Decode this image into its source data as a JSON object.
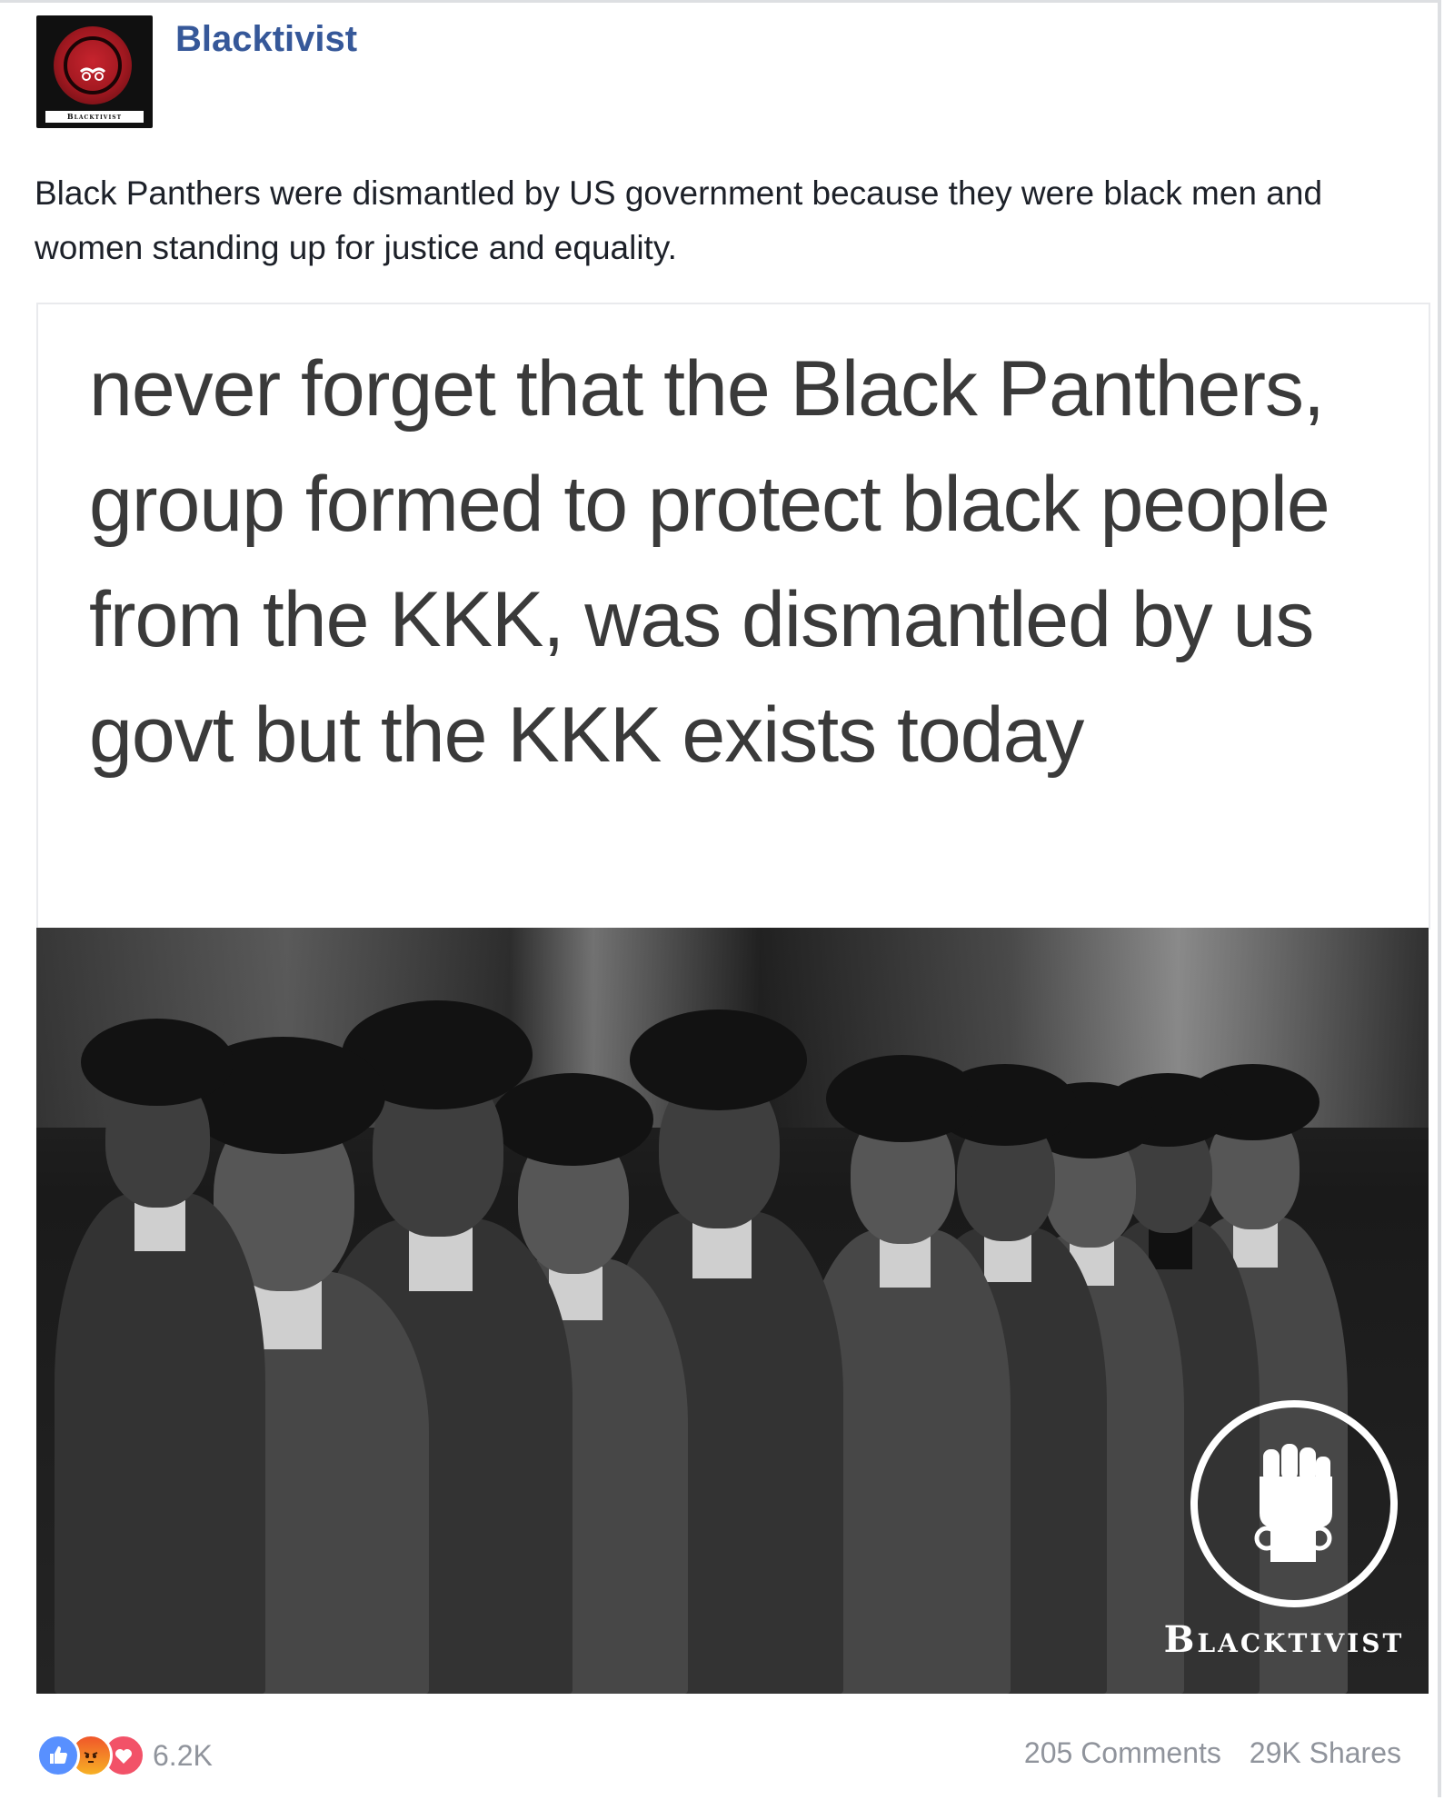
{
  "post": {
    "page_name": "Blacktivist",
    "avatar_label": "Blacktivist",
    "caption": "Black Panthers were dismantled by US government because they were black men and women standing up for justice and equality.",
    "image_text": "never forget that the Black Panthers, group formed to protect black people from the KKK, was dismantled by us govt but the KKK exists today",
    "photo_logo_text": "Blacktivist",
    "photo_description_icons": [
      "raised-fist-icon"
    ]
  },
  "footer": {
    "reaction_icons": [
      "like-icon",
      "angry-icon",
      "love-icon"
    ],
    "reaction_count": "6.2K",
    "comments": "205 Comments",
    "shares": "29K Shares"
  },
  "colors": {
    "page_name": "#365899",
    "meta_text": "#90949c",
    "like": "#5890ff",
    "love": "#f25268",
    "angry": "#f0562a"
  }
}
